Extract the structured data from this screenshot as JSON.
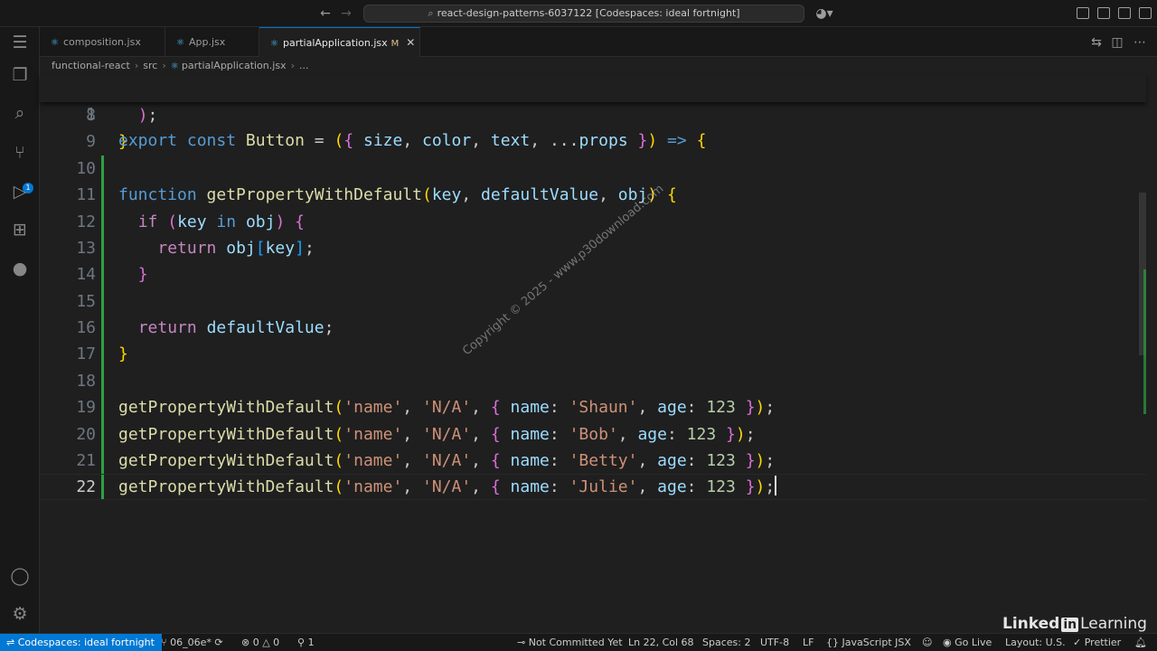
{
  "window": {
    "search_title": "react-design-patterns-6037122 [Codespaces: ideal fortnight]"
  },
  "tabs": [
    {
      "label": "composition.jsx",
      "active": false
    },
    {
      "label": "App.jsx",
      "active": false
    },
    {
      "label": "partialApplication.jsx",
      "active": true,
      "modified": "M"
    }
  ],
  "breadcrumb": [
    "functional-react",
    "src",
    "partialApplication.jsx",
    "..."
  ],
  "activity_bar": {
    "scm_badge": "1"
  },
  "editor": {
    "sticky_line": {
      "number": "1",
      "text": "export const Button = ({ size, color, text, ...props }) => {"
    },
    "lines": [
      {
        "number": "8",
        "text": "  );"
      },
      {
        "number": "9",
        "text": "}"
      },
      {
        "number": "10",
        "text": ""
      },
      {
        "number": "11",
        "text": "function getPropertyWithDefault(key, defaultValue, obj) {"
      },
      {
        "number": "12",
        "text": "  if (key in obj) {"
      },
      {
        "number": "13",
        "text": "    return obj[key];"
      },
      {
        "number": "14",
        "text": "  }"
      },
      {
        "number": "15",
        "text": ""
      },
      {
        "number": "16",
        "text": "  return defaultValue;"
      },
      {
        "number": "17",
        "text": "}"
      },
      {
        "number": "18",
        "text": ""
      },
      {
        "number": "19",
        "text": "getPropertyWithDefault('name', 'N/A', { name: 'Shaun', age: 123 });"
      },
      {
        "number": "20",
        "text": "getPropertyWithDefault('name', 'N/A', { name: 'Bob', age: 123 });"
      },
      {
        "number": "21",
        "text": "getPropertyWithDefault('name', 'N/A', { name: 'Betty', age: 123 });"
      },
      {
        "number": "22",
        "text": "getPropertyWithDefault('name', 'N/A', { name: 'Julie', age: 123 });"
      }
    ],
    "current_line": "22"
  },
  "watermark": "Copyright © 2025 - www.p30download.com",
  "statusbar": {
    "remote": "Codespaces: ideal fortnight",
    "branch": "06_06e*",
    "errors": "0",
    "warnings": "0",
    "ports": "1",
    "blame": "Not Committed Yet",
    "position": "Ln 22, Col 68",
    "spaces": "Spaces: 2",
    "encoding": "UTF-8",
    "eol": "LF",
    "language": "JavaScript JSX",
    "golive": "Go Live",
    "layout": "Layout: U.S.",
    "prettier": "Prettier"
  },
  "branding": {
    "linked": "Linked",
    "in": "in",
    "learning": "Learning"
  },
  "colors": {
    "accent": "#0078d4",
    "background": "#1f1f1f",
    "modified_gutter": "#2ea043"
  }
}
